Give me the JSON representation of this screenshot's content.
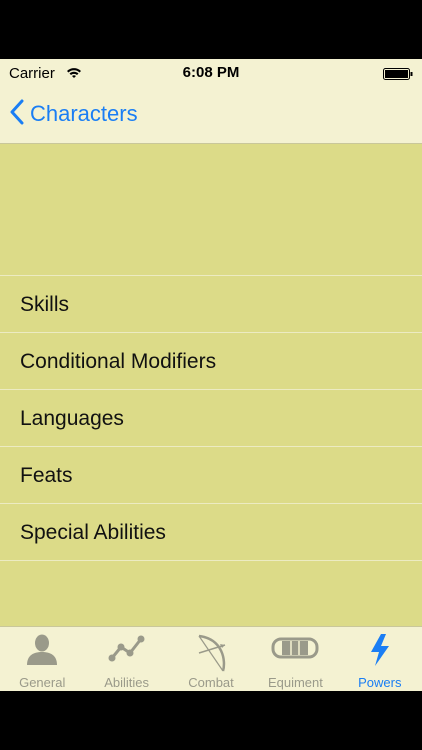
{
  "status": {
    "carrier": "Carrier",
    "time": "6:08 PM"
  },
  "nav": {
    "back_label": "Characters"
  },
  "list": {
    "items": [
      {
        "label": "Skills"
      },
      {
        "label": "Conditional Modifiers"
      },
      {
        "label": "Languages"
      },
      {
        "label": "Feats"
      },
      {
        "label": "Special Abilities"
      }
    ]
  },
  "tabbar": {
    "tabs": [
      {
        "label": "General",
        "icon": "person-icon"
      },
      {
        "label": "Abilities",
        "icon": "graph-icon"
      },
      {
        "label": "Combat",
        "icon": "bow-icon"
      },
      {
        "label": "Equiment",
        "icon": "armor-icon"
      },
      {
        "label": "Powers",
        "icon": "lightning-icon",
        "active": true
      }
    ]
  },
  "colors": {
    "accent": "#1a7ef4",
    "background": "#dcdb88",
    "bar": "#f4f2d2",
    "inactive_tab": "#9a9a8a"
  }
}
